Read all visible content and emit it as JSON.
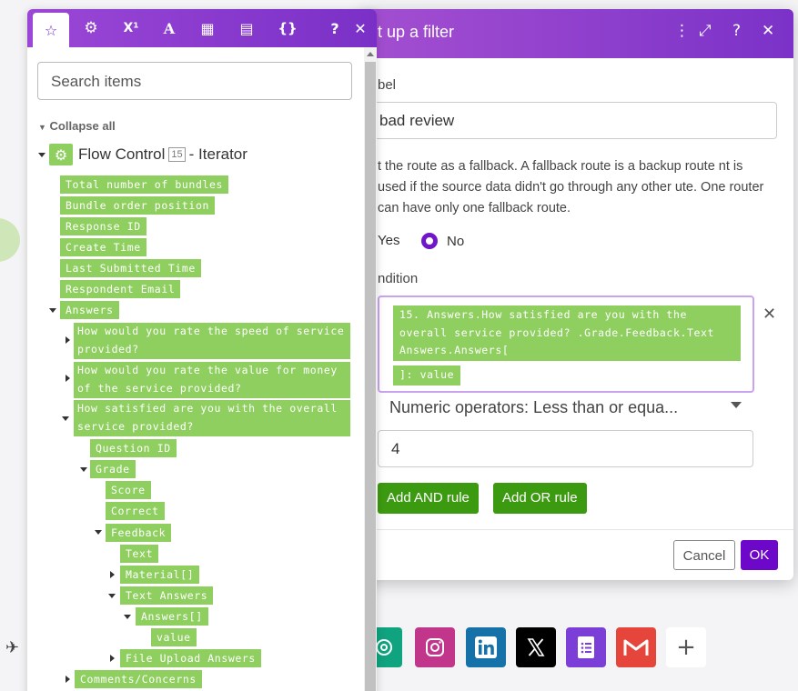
{
  "modal": {
    "title": "t up a filter",
    "label_heading": "bel",
    "label_value": "bad review",
    "fallback_text": "t the route as a fallback. A fallback route is a backup route nt is used if the source data didn't go through any other ute. One router can have only one fallback route.",
    "radio_yes": "Yes",
    "radio_no": "No",
    "radio_selected": "No",
    "condition_heading": "ndition",
    "condition_pill1": "15. Answers.How satisfied are you with the overall service provided?  .Grade.Feedback.Text Answers.Answers[",
    "condition_pill2": "]: value",
    "operator": "Numeric operators: Less than or equa...",
    "value": "4",
    "add_and": "Add AND rule",
    "add_or": "Add OR rule",
    "cancel": "Cancel",
    "ok": "OK"
  },
  "panel": {
    "tabs": [
      "star-icon",
      "gear-icon",
      "superscript-icon",
      "text-icon",
      "calendar-icon",
      "table-icon",
      "braces-icon"
    ],
    "tab_glyphs": [
      "☆",
      "⚙",
      "X¹",
      "A",
      "▦",
      "▤",
      "{}"
    ],
    "help": "?",
    "close": "✕",
    "search_placeholder": "Search items",
    "collapse_all": "Collapse all",
    "module_name": "Flow Control",
    "module_badge": "15",
    "module_suffix": "- Iterator",
    "items": {
      "total_bundles": "Total number of bundles",
      "bundle_order": "Bundle order position",
      "response_id": "Response ID",
      "create_time": "Create Time",
      "last_submitted": "Last Submitted Time",
      "respondent_email": "Respondent Email",
      "answers": "Answers",
      "q_speed": "How would you rate the speed of service provided?",
      "q_value": "How would you rate the value for money of the service provided?",
      "q_satisfied": "How satisfied are you with the overall service provided?",
      "question_id": "Question ID",
      "grade": "Grade",
      "score": "Score",
      "correct": "Correct",
      "feedback": "Feedback",
      "text": "Text",
      "material": "Material[]",
      "text_answers": "Text Answers",
      "answers_arr": "Answers[]",
      "value": "value",
      "file_upload": "File Upload Answers",
      "comments": "Comments/Concerns"
    }
  },
  "colors": {
    "header_purple": "#8a3dcd",
    "pill_green": "#8fcf60",
    "button_green": "#3c9a10",
    "ok_purple": "#6d07c9"
  },
  "app_icons": [
    "openai-icon",
    "instagram-icon",
    "linkedin-icon",
    "x-icon",
    "google-forms-icon",
    "gmail-icon",
    "add-icon"
  ]
}
